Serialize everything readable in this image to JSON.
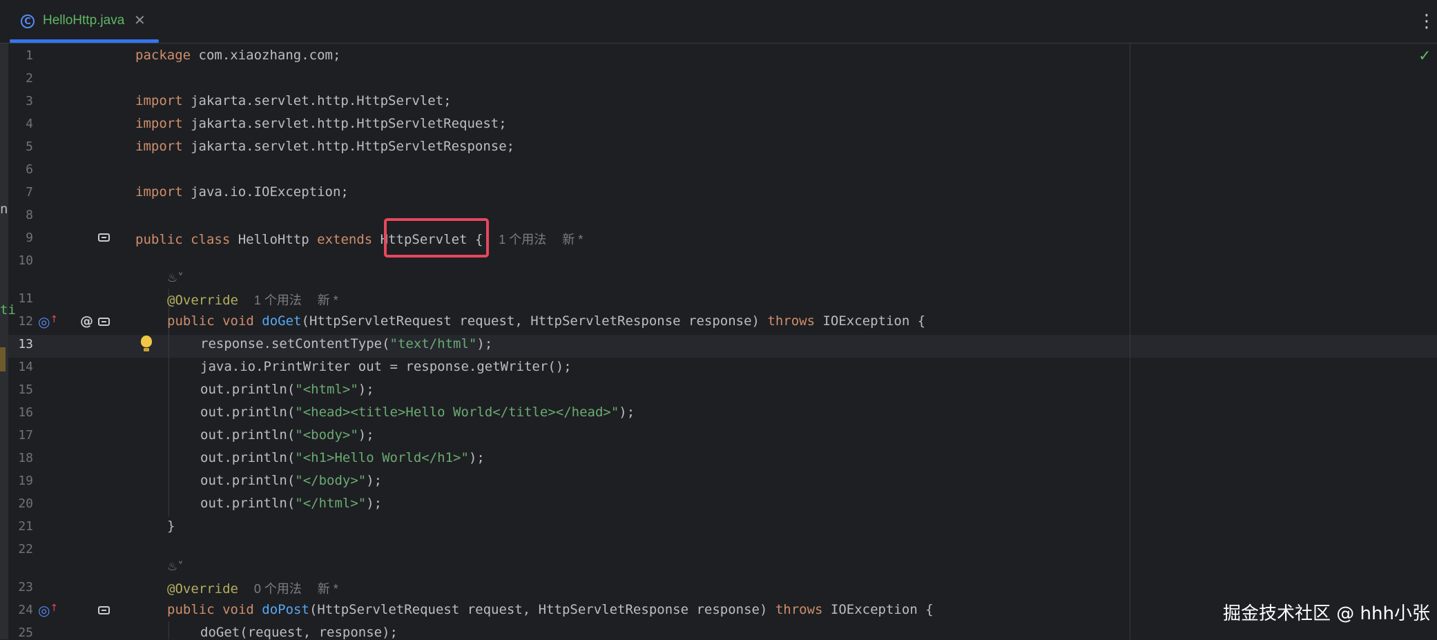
{
  "tab": {
    "label": "HelloHttp.java",
    "icon": "class-file-icon",
    "close_glyph": "✕"
  },
  "toolbar": {
    "more_glyph": "⋮"
  },
  "inspection": {
    "status_glyph": "✓"
  },
  "edge_text": {
    "n": "n",
    "t": "ti"
  },
  "line_numbers": [
    "1",
    "2",
    "3",
    "4",
    "5",
    "6",
    "7",
    "8",
    "9",
    "10",
    "11",
    "12",
    "13",
    "14",
    "15",
    "16",
    "17",
    "18",
    "19",
    "20",
    "21",
    "22",
    "23",
    "24",
    "25"
  ],
  "current_line": "13",
  "code": {
    "l1": {
      "kw": "package",
      "rest": " com.xiaozhang.com;"
    },
    "l3": {
      "kw": "import",
      "rest": " jakarta.servlet.http.HttpServlet;"
    },
    "l4": {
      "kw": "import",
      "rest": " jakarta.servlet.http.HttpServletRequest;"
    },
    "l5": {
      "kw": "import",
      "rest": " jakarta.servlet.http.HttpServletResponse;"
    },
    "l7": {
      "kw": "import",
      "rest": " java.io.IOException;"
    },
    "l9": {
      "kw1": "public class",
      "name": " HelloHttp ",
      "kw2": "extends",
      "super": "HttpServlet",
      "brace": " {",
      "usages": "1 个用法",
      "new": "新 *"
    },
    "l11": {
      "annotation": "@Override",
      "usages": "1 个用法",
      "new": "新 *"
    },
    "l12": {
      "kw": "public void",
      "method": "doGet",
      "params": "(HttpServletRequest request, HttpServletResponse response) ",
      "throws": "throws",
      "exc": " IOException {"
    },
    "l13": {
      "pre": "response.setContentType(",
      "str": "\"text/html\"",
      "post": ");"
    },
    "l14": {
      "text": "java.io.PrintWriter out = response.getWriter();"
    },
    "l15": {
      "pre": "out.println(",
      "str": "\"<html>\"",
      "post": ");"
    },
    "l16": {
      "pre": "out.println(",
      "str": "\"<head><title>Hello World</title></head>\"",
      "post": ");"
    },
    "l17": {
      "pre": "out.println(",
      "str": "\"<body>\"",
      "post": ");"
    },
    "l18": {
      "pre": "out.println(",
      "str": "\"<h1>Hello World</h1>\"",
      "post": ");"
    },
    "l19": {
      "pre": "out.println(",
      "str": "\"</body>\"",
      "post": ");"
    },
    "l20": {
      "pre": "out.println(",
      "str": "\"</html>\"",
      "post": ");"
    },
    "l21": {
      "text": "}"
    },
    "l23": {
      "annotation": "@Override",
      "usages": "0 个用法",
      "new": "新 *"
    },
    "l24": {
      "kw": "public void",
      "method": "doPost",
      "params": "(HttpServletRequest request, HttpServletResponse response) ",
      "throws": "throws",
      "exc": " IOException {"
    },
    "l25": {
      "text": "doGet(request, response);"
    }
  },
  "inlay": {
    "author_glyph": "♨˅"
  },
  "watermark": "掘金技术社区 @ hhh小张",
  "colors": {
    "accent": "#3574f0",
    "highlight": "#e5485f",
    "keyword": "#cf8e6d",
    "string": "#6aab73",
    "method": "#56a8f5",
    "annotation": "#b3ae60"
  }
}
